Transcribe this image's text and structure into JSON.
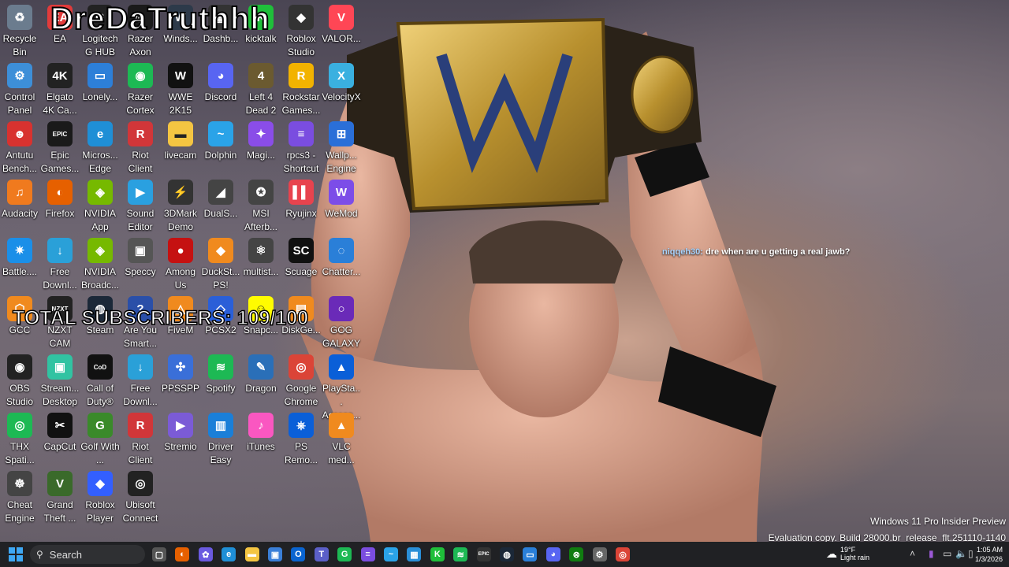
{
  "overlay": {
    "streamer_name": "DreDaTruthhh",
    "subscribers": "TOTAL SUBSCRIBERS: 109/100",
    "chat_user": "niqqeh30:",
    "chat_message": "dre when are u getting a real jawb?"
  },
  "watermark": {
    "line1": "Windows 11 Pro Insider Preview",
    "line2": "Evaluation copy. Build 28000.br_release_flt.251110-1140"
  },
  "desktop_icons": [
    {
      "label": "Recycle Bin",
      "icon": "recycle-bin-icon",
      "color": "#6b7c8e",
      "glyph": "♻"
    },
    {
      "label": "EA",
      "icon": "ea-icon",
      "color": "#e23b3b",
      "glyph": "EA"
    },
    {
      "label": "Logitech G HUB",
      "icon": "logitech-icon",
      "color": "#222",
      "glyph": "G"
    },
    {
      "label": "Razer Axon",
      "icon": "razer-icon",
      "color": "#1a1a1a",
      "glyph": "◎"
    },
    {
      "label": "Winds...",
      "icon": "windscribe-icon",
      "color": "#2d3a4a",
      "glyph": "W"
    },
    {
      "label": "Dashb...",
      "icon": "dashboard-icon",
      "color": "#333",
      "glyph": "▦"
    },
    {
      "label": "kicktalk",
      "icon": "kick-icon",
      "color": "#1fbf3a",
      "glyph": "K"
    },
    {
      "label": "Roblox Studio",
      "icon": "roblox-studio-icon",
      "color": "#333",
      "glyph": "◆"
    },
    {
      "label": "VALOR...",
      "icon": "valorant-icon",
      "color": "#ff4655",
      "glyph": "V"
    },
    {
      "label": "Control Panel",
      "icon": "control-panel-icon",
      "color": "#3d8fd8",
      "glyph": "⚙"
    },
    {
      "label": "Elgato 4K Ca...",
      "icon": "elgato-icon",
      "color": "#222",
      "glyph": "4K"
    },
    {
      "label": "Lonely...",
      "icon": "lonely-screen-icon",
      "color": "#2d7fd8",
      "glyph": "▭"
    },
    {
      "label": "Razer Cortex",
      "icon": "razer-cortex-icon",
      "color": "#1db954",
      "glyph": "◉"
    },
    {
      "label": "WWE 2K15",
      "icon": "wwe-icon",
      "color": "#111",
      "glyph": "W"
    },
    {
      "label": "Discord",
      "icon": "discord-icon",
      "color": "#5865f2",
      "glyph": "◕"
    },
    {
      "label": "Left 4 Dead 2",
      "icon": "l4d2-icon",
      "color": "#6b5a30",
      "glyph": "4"
    },
    {
      "label": "Rockstar Games...",
      "icon": "rockstar-icon",
      "color": "#f2b300",
      "glyph": "R"
    },
    {
      "label": "VelocityX",
      "icon": "velocityx-icon",
      "color": "#3ab0e0",
      "glyph": "X"
    },
    {
      "label": "Antutu Bench...",
      "icon": "antutu-icon",
      "color": "#d8322f",
      "glyph": "☻"
    },
    {
      "label": "Epic Games...",
      "icon": "epic-icon",
      "color": "#1a1a1a",
      "glyph": "EPIC"
    },
    {
      "label": "Micros... Edge",
      "icon": "edge-icon",
      "color": "#1f8fd6",
      "glyph": "e"
    },
    {
      "label": "Riot Client",
      "icon": "riot-icon",
      "color": "#d13639",
      "glyph": "R"
    },
    {
      "label": "livecam",
      "icon": "folder-icon",
      "color": "#f4c542",
      "glyph": "▬"
    },
    {
      "label": "Dolphin",
      "icon": "dolphin-icon",
      "color": "#2aa3e8",
      "glyph": "~"
    },
    {
      "label": "Magi...",
      "icon": "magi-icon",
      "color": "#8a4de8",
      "glyph": "✦"
    },
    {
      "label": "rpcs3 - Shortcut",
      "icon": "rpcs3-icon",
      "color": "#7a4de0",
      "glyph": "≡"
    },
    {
      "label": "Wallp... Engine",
      "icon": "wallpaper-engine-icon",
      "color": "#2a6fd8",
      "glyph": "⊞"
    },
    {
      "label": "Audacity",
      "icon": "audacity-icon",
      "color": "#f07a1e",
      "glyph": "♫"
    },
    {
      "label": "Firefox",
      "icon": "firefox-icon",
      "color": "#e66000",
      "glyph": "◐"
    },
    {
      "label": "NVIDIA App",
      "icon": "nvidia-icon",
      "color": "#76b900",
      "glyph": "◈"
    },
    {
      "label": "Sound Editor",
      "icon": "sound-editor-icon",
      "color": "#2aa0e0",
      "glyph": "▶"
    },
    {
      "label": "3DMark Demo",
      "icon": "3dmark-icon",
      "color": "#333",
      "glyph": "⚡"
    },
    {
      "label": "DualS...",
      "icon": "dualsense-icon",
      "color": "#444",
      "glyph": "◢"
    },
    {
      "label": "MSI Afterb...",
      "icon": "msi-icon",
      "color": "#444",
      "glyph": "✪"
    },
    {
      "label": "Ryujinx",
      "icon": "ryujinx-icon",
      "color": "#e8434e",
      "glyph": "▌▌"
    },
    {
      "label": "WeMod",
      "icon": "wemod-icon",
      "color": "#7c4de8",
      "glyph": "W"
    },
    {
      "label": "Battle....",
      "icon": "battlenet-icon",
      "color": "#1a8fe8",
      "glyph": "✷"
    },
    {
      "label": "Free Downl...",
      "icon": "free-download-icon",
      "color": "#2aa0d8",
      "glyph": "↓"
    },
    {
      "label": "NVIDIA Broadc...",
      "icon": "nvidia-broadcast-icon",
      "color": "#76b900",
      "glyph": "◈"
    },
    {
      "label": "Speccy",
      "icon": "speccy-icon",
      "color": "#555",
      "glyph": "▣"
    },
    {
      "label": "Among Us",
      "icon": "among-us-icon",
      "color": "#c51111",
      "glyph": "●"
    },
    {
      "label": "DuckSt... PS!",
      "icon": "duckstation-icon",
      "color": "#f08a1e",
      "glyph": "◆"
    },
    {
      "label": "multist...",
      "icon": "multistream-icon",
      "color": "#444",
      "glyph": "⚛"
    },
    {
      "label": "Scuage",
      "icon": "scuage-icon",
      "color": "#111",
      "glyph": "SC"
    },
    {
      "label": "Chatter...",
      "icon": "chatterino-icon",
      "color": "#2a7fd8",
      "glyph": "◌"
    },
    {
      "label": "GCC",
      "icon": "gcc-icon",
      "color": "#f08a1e",
      "glyph": "⬡"
    },
    {
      "label": "NZXT CAM",
      "icon": "nzxt-icon",
      "color": "#222",
      "glyph": "NZXT"
    },
    {
      "label": "Steam",
      "icon": "steam-icon",
      "color": "#1b2838",
      "glyph": "◍"
    },
    {
      "label": "Are You Smart...",
      "icon": "are-you-smart-icon",
      "color": "#2a4fa8",
      "glyph": "?"
    },
    {
      "label": "FiveM",
      "icon": "fivem-icon",
      "color": "#f08a1e",
      "glyph": "△"
    },
    {
      "label": "PCSX2",
      "icon": "pcsx2-icon",
      "color": "#2a5fd8",
      "glyph": "◇"
    },
    {
      "label": "Snapc...",
      "icon": "snapchat-icon",
      "color": "#fffc00",
      "glyph": "☺"
    },
    {
      "label": "DiskGe...",
      "icon": "diskgenius-icon",
      "color": "#f08a1e",
      "glyph": "▤"
    },
    {
      "label": "GOG GALAXY",
      "icon": "gog-icon",
      "color": "#6a2ab8",
      "glyph": "○"
    },
    {
      "label": "OBS Studio",
      "icon": "obs-icon",
      "color": "#222",
      "glyph": "◉"
    },
    {
      "label": "Stream... Desktop",
      "icon": "streamlabs-icon",
      "color": "#31c3a2",
      "glyph": "▣"
    },
    {
      "label": "Call of Duty®",
      "icon": "call-of-duty-icon",
      "color": "#111",
      "glyph": "CoD"
    },
    {
      "label": "Free Downl...",
      "icon": "free-download-icon",
      "color": "#2aa0d8",
      "glyph": "↓"
    },
    {
      "label": "PPSSPP",
      "icon": "ppsspp-icon",
      "color": "#3a6fd8",
      "glyph": "✣"
    },
    {
      "label": "Spotify",
      "icon": "spotify-icon",
      "color": "#1db954",
      "glyph": "≋"
    },
    {
      "label": "Dragon",
      "icon": "dragon-icon",
      "color": "#2a6fb8",
      "glyph": "✎"
    },
    {
      "label": "Google Chrome",
      "icon": "chrome-icon",
      "color": "#db4437",
      "glyph": "◎"
    },
    {
      "label": "PlaySta... Access...",
      "icon": "playstation-icon",
      "color": "#0a5fd8",
      "glyph": "▲"
    },
    {
      "label": "THX Spati...",
      "icon": "thx-icon",
      "color": "#1db954",
      "glyph": "◎"
    },
    {
      "label": "CapCut",
      "icon": "capcut-icon",
      "color": "#111",
      "glyph": "✂"
    },
    {
      "label": "Golf With ...",
      "icon": "golf-icon",
      "color": "#3a8a2a",
      "glyph": "G"
    },
    {
      "label": "Riot Client",
      "icon": "riot-icon",
      "color": "#d13639",
      "glyph": "R"
    },
    {
      "label": "Stremio",
      "icon": "stremio-icon",
      "color": "#7b5bd6",
      "glyph": "▶"
    },
    {
      "label": "Driver Easy",
      "icon": "driver-easy-icon",
      "color": "#1a7fd8",
      "glyph": "▥"
    },
    {
      "label": "iTunes",
      "icon": "itunes-icon",
      "color": "#fa57c1",
      "glyph": "♪"
    },
    {
      "label": "PS Remo...",
      "icon": "ps-remote-icon",
      "color": "#0a5fd8",
      "glyph": "⎈"
    },
    {
      "label": "VLC med...",
      "icon": "vlc-icon",
      "color": "#f08a1e",
      "glyph": "▲"
    },
    {
      "label": "Cheat Engine",
      "icon": "cheat-engine-icon",
      "color": "#444",
      "glyph": "☸"
    },
    {
      "label": "Grand Theft ...",
      "icon": "gta-icon",
      "color": "#3a6a2a",
      "glyph": "V"
    },
    {
      "label": "Roblox Player",
      "icon": "roblox-icon",
      "color": "#335fff",
      "glyph": "◆"
    },
    {
      "label": "Ubisoft Connect",
      "icon": "ubisoft-icon",
      "color": "#222",
      "glyph": "◎"
    }
  ],
  "taskbar": {
    "search_label": "Search",
    "weather_temp": "19°F",
    "weather_desc": "Light rain",
    "time": "1:05 AM",
    "date": "1/3/2026",
    "pinned": [
      {
        "icon": "task-view-icon",
        "color": "#555",
        "glyph": "▢"
      },
      {
        "icon": "firefox-icon",
        "color": "#e66000",
        "glyph": "◐"
      },
      {
        "icon": "copilot-icon",
        "color": "#6a5ae0",
        "glyph": "✿"
      },
      {
        "icon": "edge-icon",
        "color": "#1f8fd6",
        "glyph": "e"
      },
      {
        "icon": "file-explorer-icon",
        "color": "#f4c542",
        "glyph": "▬"
      },
      {
        "icon": "store-icon",
        "color": "#3a7fd8",
        "glyph": "▣"
      },
      {
        "icon": "outlook-icon",
        "color": "#0a64d0",
        "glyph": "O"
      },
      {
        "icon": "teams-icon",
        "color": "#5b5fc7",
        "glyph": "T"
      },
      {
        "icon": "game-bar-icon",
        "color": "#1db954",
        "glyph": "G"
      },
      {
        "icon": "rpcs3-icon",
        "color": "#7a4de0",
        "glyph": "≡"
      },
      {
        "icon": "dolphin-icon",
        "color": "#2aa3e8",
        "glyph": "~"
      },
      {
        "icon": "photos-icon",
        "color": "#2a8fd8",
        "glyph": "▦"
      },
      {
        "icon": "kick-icon",
        "color": "#1fbf3a",
        "glyph": "K"
      },
      {
        "icon": "spotify-icon",
        "color": "#1db954",
        "glyph": "≋"
      },
      {
        "icon": "epic-icon",
        "color": "#333",
        "glyph": "EPIC"
      },
      {
        "icon": "steam-icon",
        "color": "#1b2838",
        "glyph": "◍"
      },
      {
        "icon": "remote-desktop-icon",
        "color": "#2a7fd8",
        "glyph": "▭"
      },
      {
        "icon": "discord-icon",
        "color": "#5865f2",
        "glyph": "◕"
      },
      {
        "icon": "xbox-icon",
        "color": "#107c10",
        "glyph": "⊗"
      },
      {
        "icon": "settings-icon",
        "color": "#666",
        "glyph": "⚙"
      },
      {
        "icon": "chrome-icon",
        "color": "#db4437",
        "glyph": "◎"
      }
    ]
  }
}
